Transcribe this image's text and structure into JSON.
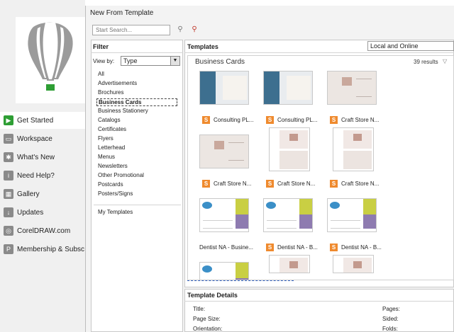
{
  "dialog": {
    "title": "New From Template"
  },
  "search": {
    "placeholder": "Start Search..."
  },
  "left_nav": [
    {
      "label": "Get Started",
      "icon": "play-icon",
      "glyph": "▶",
      "active": true
    },
    {
      "label": "Workspace",
      "icon": "workspace-icon",
      "glyph": "▭"
    },
    {
      "label": "What's New",
      "icon": "star-icon",
      "glyph": "✱"
    },
    {
      "label": "Need Help?",
      "icon": "info-icon",
      "glyph": "i"
    },
    {
      "label": "Gallery",
      "icon": "gallery-icon",
      "glyph": "▦"
    },
    {
      "label": "Updates",
      "icon": "download-icon",
      "glyph": "↓"
    },
    {
      "label": "CorelDRAW.com",
      "icon": "globe-icon",
      "glyph": "◎"
    },
    {
      "label": "Membership & Subsc",
      "icon": "membership-icon",
      "glyph": "P"
    }
  ],
  "filter": {
    "heading": "Filter",
    "view_by_label": "View by:",
    "view_by_value": "Type",
    "types": [
      "All",
      "Advertisements",
      "Brochures",
      "Business Cards",
      "Business Stationery",
      "Catalogs",
      "Certificates",
      "Flyers",
      "Letterhead",
      "Menus",
      "Newsletters",
      "Other Promotional",
      "Postcards",
      "Posters/Signs"
    ],
    "selected_type": "Business Cards",
    "my_templates": "My Templates"
  },
  "templates": {
    "heading": "Templates",
    "location": "Local and Online",
    "category": "Business Cards",
    "results": "39 results",
    "items": [
      {
        "name": "Consulting PL...",
        "style": "blue",
        "badge": "S"
      },
      {
        "name": "Consulting PL...",
        "style": "blue",
        "badge": "S"
      },
      {
        "name": "Craft Store N...",
        "style": "craft",
        "badge": "S"
      },
      {
        "name": "Craft Store N...",
        "style": "craft",
        "badge": "S"
      },
      {
        "name": "Craft Store N...",
        "style": "vcraft",
        "badge": "S"
      },
      {
        "name": "Craft Store N...",
        "style": "vcraft",
        "badge": "S"
      },
      {
        "name": "Dentist NA - Busine...",
        "style": "dent",
        "badge": ""
      },
      {
        "name": "Dentist NA - B...",
        "style": "dent",
        "badge": "S"
      },
      {
        "name": "Dentist NA - B...",
        "style": "dent",
        "badge": "S"
      },
      {
        "name": "",
        "style": "dent",
        "badge": ""
      },
      {
        "name": "",
        "style": "vcraft",
        "badge": ""
      },
      {
        "name": "",
        "style": "vcraft",
        "badge": ""
      }
    ]
  },
  "details": {
    "heading": "Template Details",
    "title_label": "Title:",
    "page_size_label": "Page Size:",
    "orientation_label": "Orientation:",
    "pages_label": "Pages:",
    "sided_label": "Sided:",
    "folds_label": "Folds:"
  },
  "colors": {
    "active_green": "#2e9e34",
    "badge_orange": "#ef8a2e",
    "balloon_gray": "#9b9b9b"
  }
}
